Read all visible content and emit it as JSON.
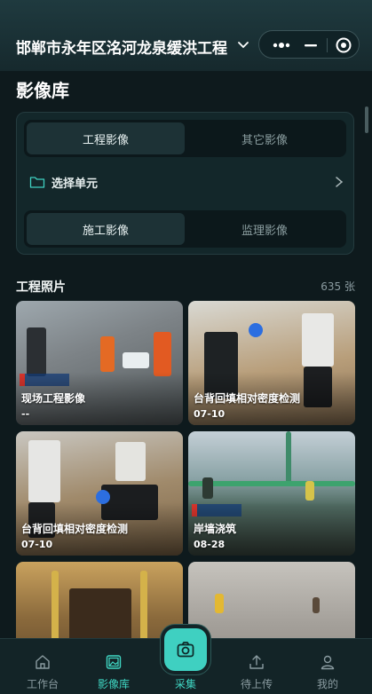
{
  "header": {
    "title": "邯郸市永年区洺河龙泉缓洪工程"
  },
  "page": {
    "title": "影像库"
  },
  "filters": {
    "primary_tabs": [
      "工程影像",
      "其它影像"
    ],
    "unit_label": "选择单元",
    "secondary_tabs": [
      "施工影像",
      "监理影像"
    ]
  },
  "photos": {
    "section_title": "工程照片",
    "count": "635 张",
    "items": [
      {
        "caption": "现场工程影像",
        "date": "--"
      },
      {
        "caption": "台背回填相对密度检测",
        "date": "07-10"
      },
      {
        "caption": "台背回填相对密度检测",
        "date": "07-10"
      },
      {
        "caption": "岸墙浇筑",
        "date": "08-28"
      },
      {
        "caption": "",
        "date": ""
      },
      {
        "caption": "",
        "date": ""
      }
    ]
  },
  "tabbar": {
    "items": [
      "工作台",
      "影像库",
      "采集",
      "待上传",
      "我的"
    ],
    "active": "影像库"
  },
  "colors": {
    "accent": "#3fd0c1",
    "background": "#0e1a1d"
  }
}
